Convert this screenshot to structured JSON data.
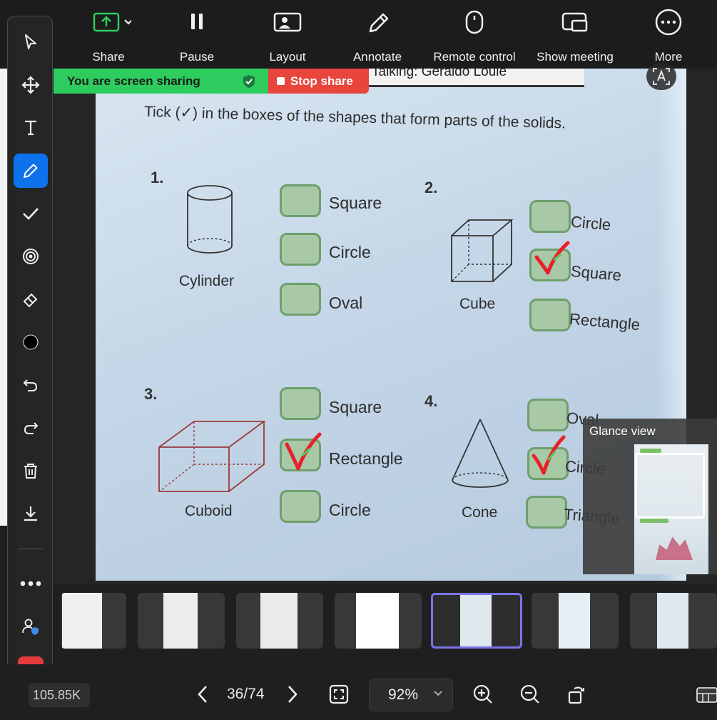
{
  "toolbar": {
    "share": "Share",
    "pause": "Pause",
    "layout": "Layout",
    "annotate": "Annotate",
    "remote_control": "Remote control",
    "show_meeting": "Show meeting",
    "more": "More"
  },
  "sharing": {
    "banner": "You are screen sharing",
    "stop": "Stop share",
    "talking": "Talking: Geraldo Louie"
  },
  "worksheet": {
    "instruction": "Tick (✓) in the boxes of the shapes that form parts of the solids.",
    "q1": {
      "num": "1.",
      "solid": "Cylinder",
      "options": [
        "Square",
        "Circle",
        "Oval"
      ]
    },
    "q2": {
      "num": "2.",
      "solid": "Cube",
      "options": [
        "Circle",
        "Square",
        "Rectangle"
      ]
    },
    "q3": {
      "num": "3.",
      "solid": "Cuboid",
      "options": [
        "Square",
        "Rectangle",
        "Circle"
      ]
    },
    "q4": {
      "num": "4.",
      "solid": "Cone",
      "options": [
        "Oval",
        "Circle",
        "Triangle"
      ]
    },
    "ticked": [
      "q2.Square",
      "q3.Rectangle",
      "q4.Circle"
    ]
  },
  "glance": {
    "title": "Glance view"
  },
  "bottom": {
    "file_size": "105.85K",
    "page": "36/74",
    "zoom": "92%"
  },
  "colors": {
    "banner_green": "#2ecc5e",
    "stop_red": "#e8453c",
    "active_tool": "#0e72ed",
    "tick_red": "#e8202a",
    "selected_thumb": "#7b74e8"
  }
}
